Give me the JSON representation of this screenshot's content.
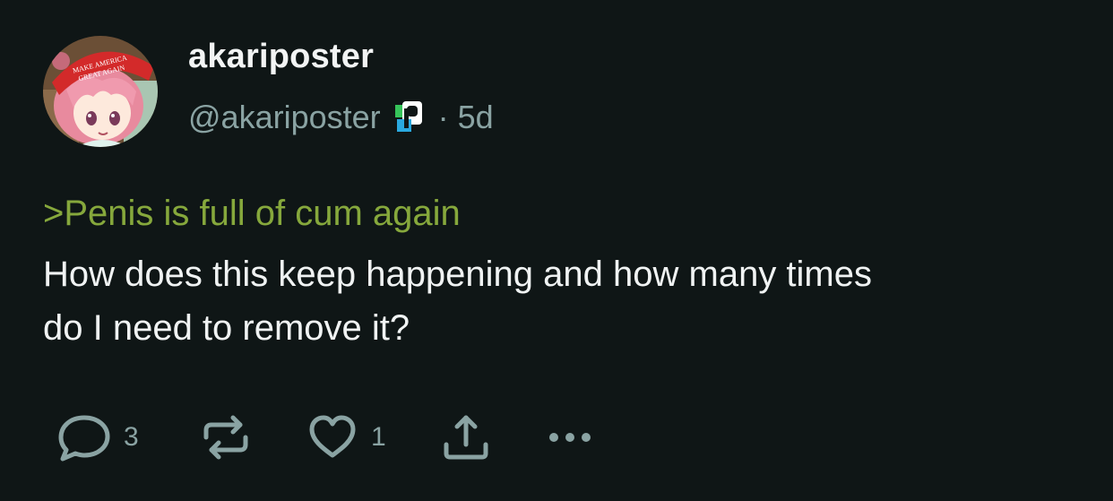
{
  "post": {
    "display_name": "akariposter",
    "handle": "@akariposter",
    "separator": "·",
    "age": "5d",
    "greentext": ">Penis is full of cum again",
    "body": "How does this keep happening and how many times\ndo I need to remove it?",
    "avatar_hat_text": "MAKE AMERICA GREAT AGAIN",
    "actions": {
      "reply_count": "3",
      "repost_count": "",
      "like_count": "1"
    }
  },
  "icons": {
    "reply": "speech-bubble-icon",
    "repost": "repost-arrows-icon",
    "like": "heart-icon",
    "share": "share-upload-icon",
    "more": "ellipsis-icon",
    "badge": "pronoun-badge-icon"
  },
  "colors": {
    "background": "#0f1616",
    "text_primary": "#f0f3f3",
    "text_secondary": "#8aa3a3",
    "greentext": "#86a83c"
  }
}
